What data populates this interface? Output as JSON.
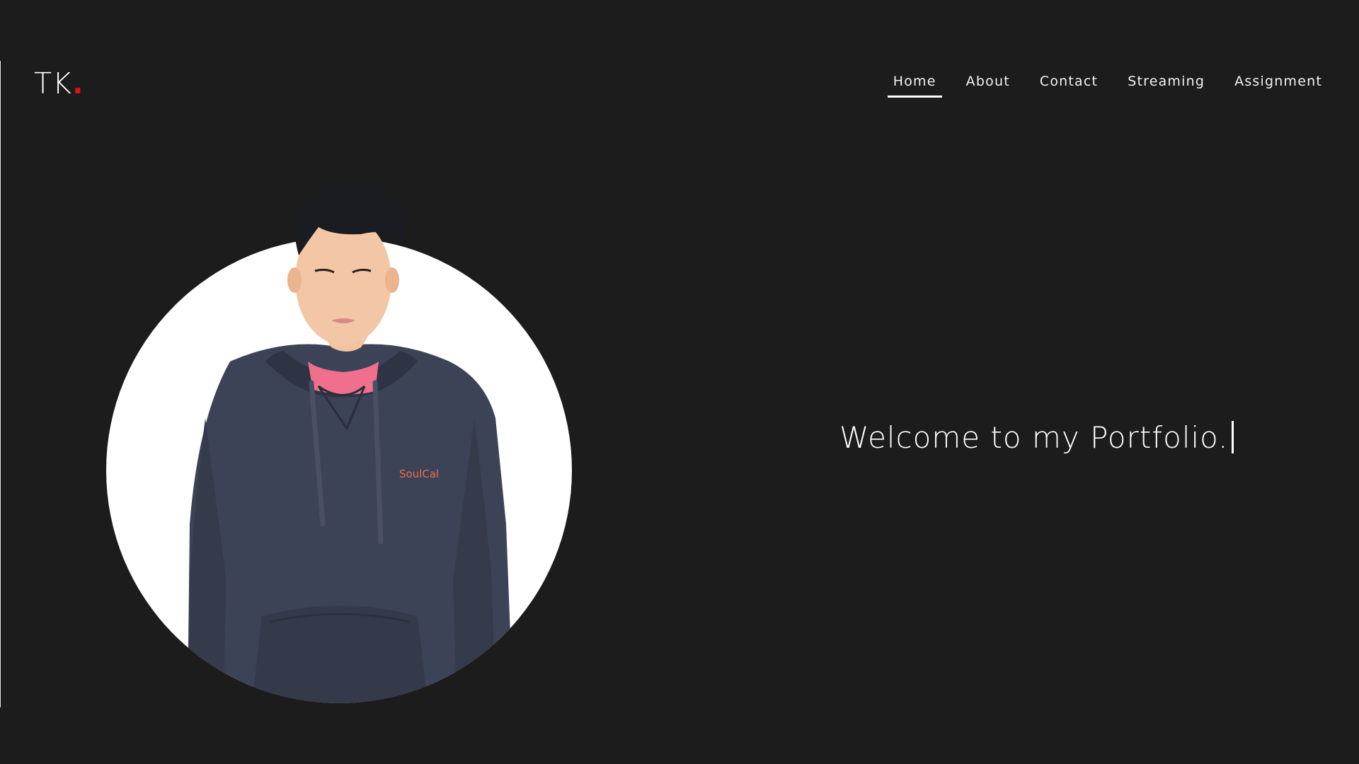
{
  "header": {
    "logo_text": "TK",
    "logo_dot": ".",
    "logo_dot_color": "#e01010"
  },
  "nav": {
    "items": [
      {
        "label": "Home",
        "active": true
      },
      {
        "label": "About",
        "active": false
      },
      {
        "label": "Contact",
        "active": false
      },
      {
        "label": "Streaming",
        "active": false
      },
      {
        "label": "Assignment",
        "active": false
      }
    ]
  },
  "hero": {
    "welcome_text": "Welcome to my Portfolio.",
    "hoodie_brand_text": "SoulCal"
  },
  "colors": {
    "background": "#1c1c1c",
    "text": "#ffffff",
    "accent": "#e01010",
    "photo_circle": "#ffffff",
    "hoodie": "#3d4356"
  }
}
